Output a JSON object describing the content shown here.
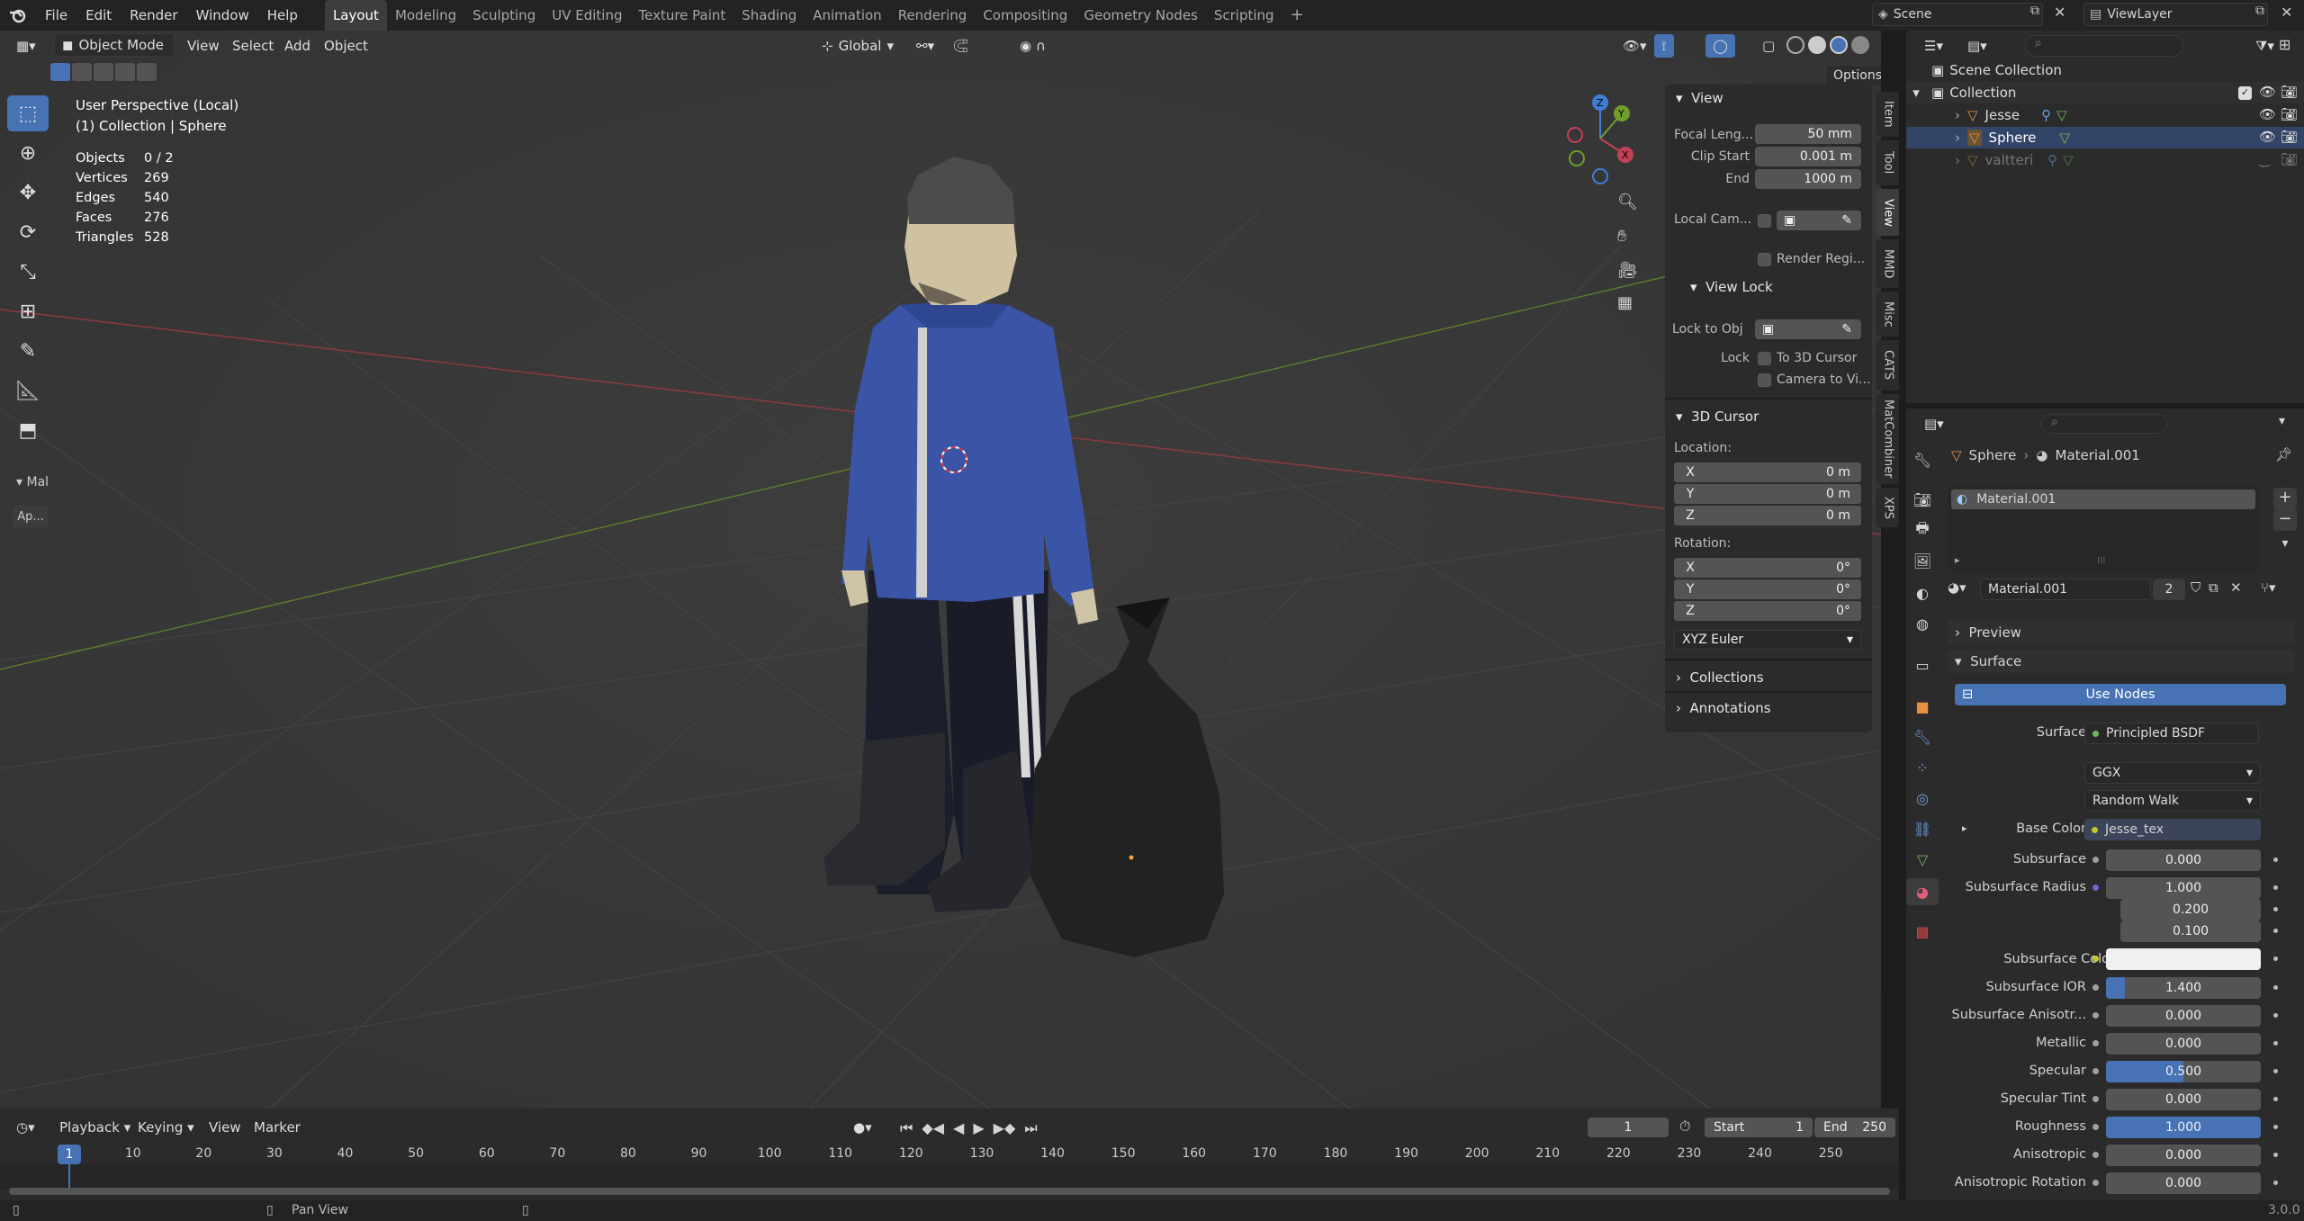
{
  "topbar": {
    "menu": [
      "File",
      "Edit",
      "Render",
      "Window",
      "Help"
    ],
    "workspaces": [
      "Layout",
      "Modeling",
      "Sculpting",
      "UV Editing",
      "Texture Paint",
      "Shading",
      "Animation",
      "Rendering",
      "Compositing",
      "Geometry Nodes",
      "Scripting"
    ],
    "active_workspace": "Layout",
    "scene": "Scene",
    "view_layer": "ViewLayer"
  },
  "viewport_header": {
    "mode": "Object Mode",
    "menus": [
      "View",
      "Select",
      "Add",
      "Object"
    ],
    "orientation": "Global",
    "options": "Options"
  },
  "viewport": {
    "perspective": "User Perspective (Local)",
    "collection": "(1) Collection | Sphere",
    "stats": [
      {
        "k": "Objects",
        "v": "0 / 2"
      },
      {
        "k": "Vertices",
        "v": "269"
      },
      {
        "k": "Edges",
        "v": "540"
      },
      {
        "k": "Faces",
        "v": "276"
      },
      {
        "k": "Triangles",
        "v": "528"
      }
    ],
    "left_panel_label": "Mal",
    "left_panel_button": "Ap...",
    "gizmo": {
      "z": "Z",
      "y": "Y",
      "x": "X"
    }
  },
  "npanel": {
    "view_title": "View",
    "focal_label": "Focal Leng...",
    "focal_value": "50 mm",
    "clip_start_label": "Clip Start",
    "clip_start_value": "0.001 m",
    "clip_end_label": "End",
    "clip_end_value": "1000 m",
    "local_cam_label": "Local Cam...",
    "render_region": "Render Regi...",
    "view_lock_title": "View Lock",
    "lock_obj_label": "Lock to Obj",
    "lock_label": "Lock",
    "to_3d_cursor": "To 3D Cursor",
    "camera_to_view": "Camera to Vi...",
    "cursor_title": "3D Cursor",
    "location_label": "Location:",
    "location": [
      {
        "ax": "X",
        "v": "0 m"
      },
      {
        "ax": "Y",
        "v": "0 m"
      },
      {
        "ax": "Z",
        "v": "0 m"
      }
    ],
    "rotation_label": "Rotation:",
    "rotation": [
      {
        "ax": "X",
        "v": "0°"
      },
      {
        "ax": "Y",
        "v": "0°"
      },
      {
        "ax": "Z",
        "v": "0°"
      }
    ],
    "rotation_mode": "XYZ Euler",
    "collections": "Collections",
    "annotations": "Annotations"
  },
  "vtabs": [
    "Item",
    "Tool",
    "View",
    "MMD",
    "Misc",
    "CATS",
    "MatCombiner",
    "XPS"
  ],
  "active_vtab": "View",
  "timeline": {
    "menus": [
      "Playback",
      "Keying",
      "View",
      "Marker"
    ],
    "current_frame": "1",
    "start_label": "Start",
    "start": "1",
    "end_label": "End",
    "end": "250",
    "ticks": [
      "1",
      "10",
      "20",
      "30",
      "40",
      "50",
      "60",
      "70",
      "80",
      "90",
      "100",
      "110",
      "120",
      "130",
      "140",
      "150",
      "160",
      "170",
      "180",
      "190",
      "200",
      "210",
      "220",
      "230",
      "240",
      "250"
    ]
  },
  "statusbar": {
    "hint": "Pan View",
    "version": "3.0.0"
  },
  "outliner": {
    "root": "Scene Collection",
    "collection": "Collection",
    "items": [
      "Jesse",
      "Sphere",
      "valtteri"
    ]
  },
  "properties": {
    "breadcrumb_object": "Sphere",
    "breadcrumb_material": "Material.001",
    "slot": "Material.001",
    "material_name": "Material.001",
    "users": "2",
    "preview": "Preview",
    "surface_panel": "Surface",
    "use_nodes": "Use Nodes",
    "surface_label": "Surface",
    "surface_value": "Principled BSDF",
    "distribution": "GGX",
    "subsurface_method": "Random Walk",
    "base_color_label": "Base Color",
    "base_color_value": "Jesse_tex",
    "rows": [
      {
        "label": "Subsurface",
        "value": "0.000",
        "fill": 0
      },
      {
        "label": "Subsurface Radius",
        "value": "1.000",
        "fill": 0
      },
      {
        "label": "",
        "value": "0.200",
        "fill": 0
      },
      {
        "label": "",
        "value": "0.100",
        "fill": 0
      },
      {
        "label": "Subsurface IOR",
        "value": "1.400",
        "fill": 0.12
      },
      {
        "label": "Subsurface Anisotr...",
        "value": "0.000",
        "fill": 0
      },
      {
        "label": "Metallic",
        "value": "0.000",
        "fill": 0
      },
      {
        "label": "Specular",
        "value": "0.500",
        "fill": 0.5
      },
      {
        "label": "Specular Tint",
        "value": "0.000",
        "fill": 0
      },
      {
        "label": "Roughness",
        "value": "1.000",
        "fill": 1
      },
      {
        "label": "Anisotropic",
        "value": "0.000",
        "fill": 0
      },
      {
        "label": "Anisotropic Rotation",
        "value": "0.000",
        "fill": 0
      }
    ],
    "subsurface_color_label": "Subsurface Color"
  },
  "colors": {
    "accent": "#4772b3",
    "x_axis": "#c24154",
    "y_axis": "#6f9e2c",
    "z_axis": "#3f7ed3"
  }
}
